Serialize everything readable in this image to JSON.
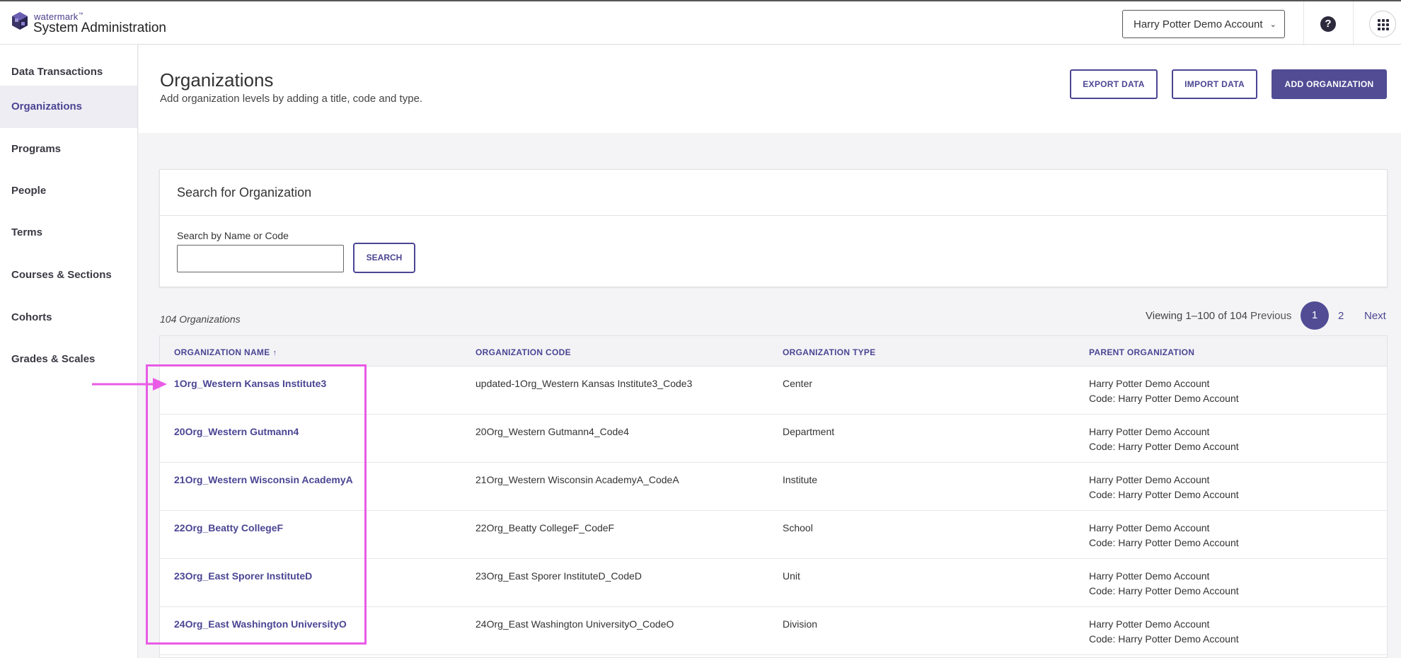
{
  "header": {
    "brand_small": "watermark",
    "brand_tm": "™",
    "brand_title": "System Administration",
    "account": "Harry Potter Demo Account",
    "help_glyph": "?",
    "icons": {
      "logo": "watermark-logo-icon",
      "chevron": "chevron-down-icon",
      "help": "help-icon",
      "apps": "apps-grid-icon"
    }
  },
  "sidebar": {
    "items": [
      {
        "label": "Data Transactions"
      },
      {
        "label": "Organizations",
        "active": true
      },
      {
        "label": "Programs"
      },
      {
        "label": "People"
      },
      {
        "label": "Terms"
      },
      {
        "label": "Courses & Sections"
      },
      {
        "label": "Cohorts"
      },
      {
        "label": "Grades & Scales"
      }
    ]
  },
  "page": {
    "title": "Organizations",
    "subtitle": "Add organization levels by adding a title, code and type.",
    "export_label": "EXPORT DATA",
    "import_label": "IMPORT DATA",
    "add_label": "ADD ORGANIZATION"
  },
  "search": {
    "title": "Search for Organization",
    "label": "Search by Name or Code",
    "value": "",
    "placeholder": "",
    "button": "SEARCH"
  },
  "results": {
    "count": "104 Organizations",
    "viewing": "Viewing 1–100 of 104",
    "previous": "Previous",
    "current_page": "1",
    "page_two": "2",
    "next": "Next"
  },
  "table": {
    "headers": {
      "name": "ORGANIZATION NAME",
      "sort_glyph": "↑",
      "code": "ORGANIZATION CODE",
      "type": "ORGANIZATION TYPE",
      "parent": "PARENT ORGANIZATION"
    },
    "rows": [
      {
        "name": "1Org_Western Kansas Institute3",
        "code": "updated-1Org_Western Kansas Institute3_Code3",
        "type": "Center",
        "parent": "Harry Potter Demo Account",
        "parent_code": "Code: Harry Potter Demo Account"
      },
      {
        "name": "20Org_Western Gutmann4",
        "code": "20Org_Western Gutmann4_Code4",
        "type": "Department",
        "parent": "Harry Potter Demo Account",
        "parent_code": "Code: Harry Potter Demo Account"
      },
      {
        "name": "21Org_Western Wisconsin AcademyA",
        "code": "21Org_Western Wisconsin AcademyA_CodeA",
        "type": "Institute",
        "parent": "Harry Potter Demo Account",
        "parent_code": "Code: Harry Potter Demo Account"
      },
      {
        "name": "22Org_Beatty CollegeF",
        "code": "22Org_Beatty CollegeF_CodeF",
        "type": "School",
        "parent": "Harry Potter Demo Account",
        "parent_code": "Code: Harry Potter Demo Account"
      },
      {
        "name": "23Org_East Sporer InstituteD",
        "code": "23Org_East Sporer InstituteD_CodeD",
        "type": "Unit",
        "parent": "Harry Potter Demo Account",
        "parent_code": "Code: Harry Potter Demo Account"
      },
      {
        "name": "24Org_East Washington UniversityO",
        "code": "24Org_East Washington UniversityO_CodeO",
        "type": "Division",
        "parent": "Harry Potter Demo Account",
        "parent_code": "Code: Harry Potter Demo Account"
      }
    ]
  },
  "colors": {
    "accent": "#4b4593",
    "annotation": "#e95be6"
  }
}
